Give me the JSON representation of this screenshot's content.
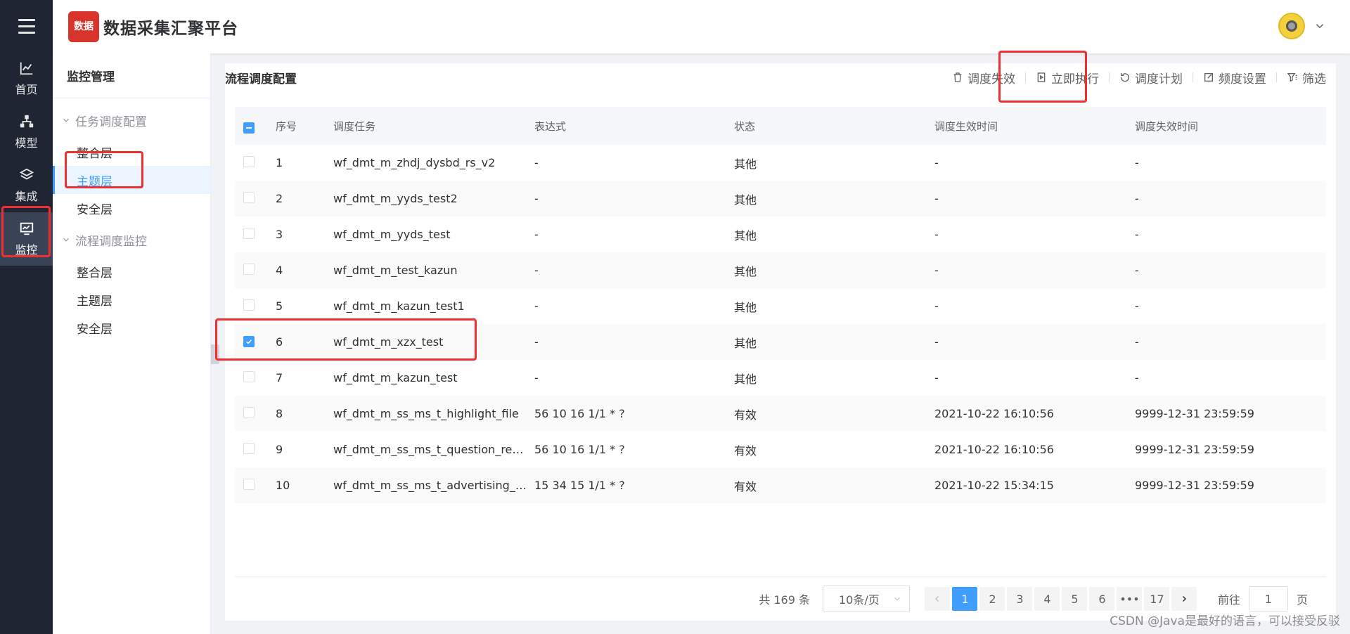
{
  "app": {
    "title": "数据采集汇聚平台",
    "logo_text": "数据"
  },
  "rail": {
    "items": [
      {
        "label": "首页",
        "icon": "line-chart-icon"
      },
      {
        "label": "模型",
        "icon": "hierarchy-icon"
      },
      {
        "label": "集成",
        "icon": "layers-icon"
      },
      {
        "label": "监控",
        "icon": "monitor-icon",
        "active": true
      }
    ]
  },
  "subnav": {
    "title": "监控管理",
    "groups": [
      {
        "label": "任务调度配置",
        "items": [
          "整合层",
          "主题层",
          "安全层"
        ],
        "active_index": 1
      },
      {
        "label": "流程调度监控",
        "items": [
          "整合层",
          "主题层",
          "安全层"
        ]
      }
    ]
  },
  "main": {
    "title": "流程调度配置",
    "toolbar": [
      {
        "label": "调度失效",
        "icon": "trash-icon"
      },
      {
        "label": "立即执行",
        "icon": "run-icon"
      },
      {
        "label": "调度计划",
        "icon": "refresh-icon"
      },
      {
        "label": "频度设置",
        "icon": "edit-icon"
      },
      {
        "label": "筛选",
        "icon": "filter-icon"
      }
    ],
    "table": {
      "headers": [
        "序号",
        "调度任务",
        "表达式",
        "状态",
        "调度生效时间",
        "调度失效时间"
      ],
      "rows": [
        {
          "no": "1",
          "task": "wf_dmt_m_zhdj_dysbd_rs_v2",
          "expr": "-",
          "state": "其他",
          "start": "-",
          "end": "-",
          "checked": false
        },
        {
          "no": "2",
          "task": "wf_dmt_m_yyds_test2",
          "expr": "-",
          "state": "其他",
          "start": "-",
          "end": "-",
          "checked": false
        },
        {
          "no": "3",
          "task": "wf_dmt_m_yyds_test",
          "expr": "-",
          "state": "其他",
          "start": "-",
          "end": "-",
          "checked": false
        },
        {
          "no": "4",
          "task": "wf_dmt_m_test_kazun",
          "expr": "-",
          "state": "其他",
          "start": "-",
          "end": "-",
          "checked": false
        },
        {
          "no": "5",
          "task": "wf_dmt_m_kazun_test1",
          "expr": "-",
          "state": "其他",
          "start": "-",
          "end": "-",
          "checked": false
        },
        {
          "no": "6",
          "task": "wf_dmt_m_xzx_test",
          "expr": "-",
          "state": "其他",
          "start": "-",
          "end": "-",
          "checked": true
        },
        {
          "no": "7",
          "task": "wf_dmt_m_kazun_test",
          "expr": "-",
          "state": "其他",
          "start": "-",
          "end": "-",
          "checked": false
        },
        {
          "no": "8",
          "task": "wf_dmt_m_ss_ms_t_highlight_file",
          "expr": "56 10 16 1/1 * ?",
          "state": "有效",
          "start": "2021-10-22 16:10:56",
          "end": "9999-12-31 23:59:59",
          "checked": false
        },
        {
          "no": "9",
          "task": "wf_dmt_m_ss_ms_t_question_res...",
          "expr": "56 10 16 1/1 * ?",
          "state": "有效",
          "start": "2021-10-22 16:10:56",
          "end": "9999-12-31 23:59:59",
          "checked": false
        },
        {
          "no": "10",
          "task": "wf_dmt_m_ss_ms_t_advertising_o...",
          "expr": "15 34 15 1/1 * ?",
          "state": "有效",
          "start": "2021-10-22 15:34:15",
          "end": "9999-12-31 23:59:59",
          "checked": false
        }
      ]
    },
    "pagination": {
      "total": "共 169 条",
      "page_size": "10条/页",
      "pages": [
        "1",
        "2",
        "3",
        "4",
        "5",
        "6",
        "•••",
        "17"
      ],
      "current": "1",
      "goto_prefix": "前往",
      "goto_value": "1",
      "goto_suffix": "页"
    }
  },
  "watermark": "CSDN @Java是最好的语言，可以接受反驳",
  "colors": {
    "primary": "#409eff",
    "rail_bg": "#1f2533",
    "annotation_red": "#f03030"
  }
}
